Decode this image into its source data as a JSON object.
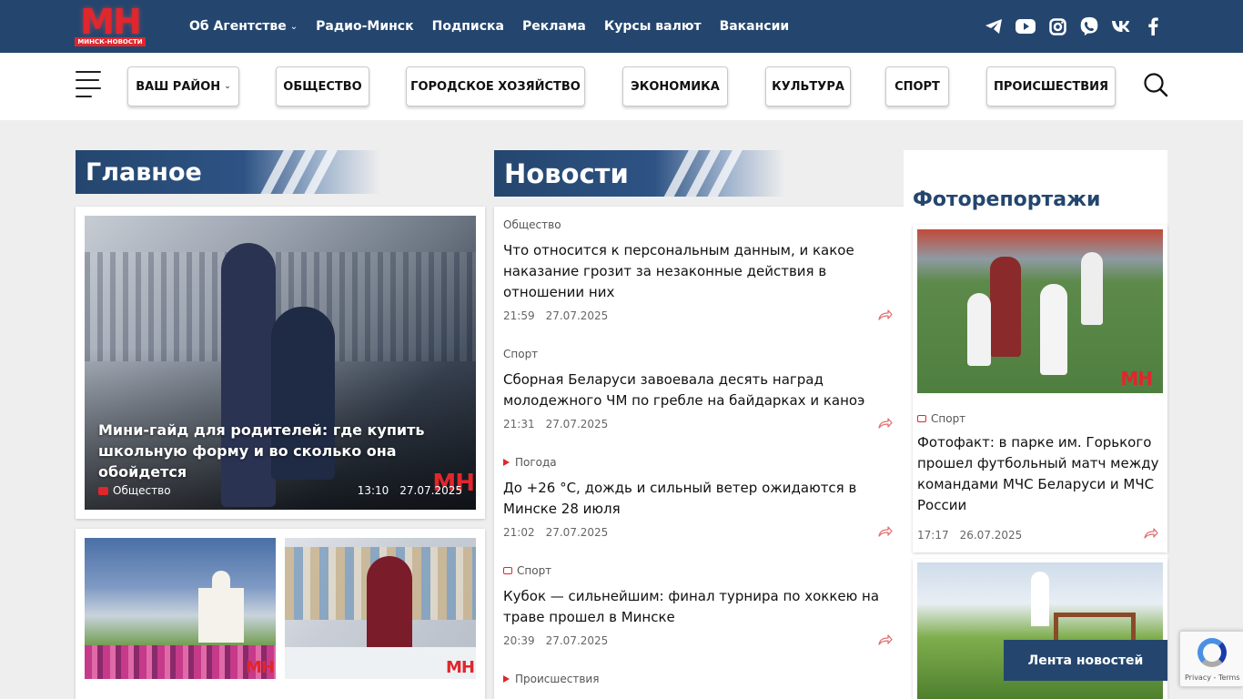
{
  "logo": {
    "letters": "МН",
    "subtitle": "МИНСК-НОВОСТИ"
  },
  "topnav": [
    {
      "label": "Об Агентстве",
      "dropdown": true
    },
    {
      "label": "Радио-Минск"
    },
    {
      "label": "Подписка"
    },
    {
      "label": "Реклама"
    },
    {
      "label": "Курсы валют"
    },
    {
      "label": "Вакансии"
    }
  ],
  "social": [
    "telegram-icon",
    "youtube-icon",
    "instagram-icon",
    "viber-icon",
    "vk-icon",
    "facebook-icon"
  ],
  "categories": [
    {
      "label": "ВАШ РАЙОН",
      "dropdown": true
    },
    {
      "label": "ОБЩЕСТВО"
    },
    {
      "label": "ГОРОДСКОЕ ХОЗЯЙСТВО"
    },
    {
      "label": "ЭКОНОМИКА"
    },
    {
      "label": "КУЛЬТУРА"
    },
    {
      "label": "СПОРТ"
    },
    {
      "label": "ПРОИСШЕСТВИЯ"
    }
  ],
  "main": {
    "heading": "Главное",
    "featured": {
      "title": "Мини-гайд для родителей: где купить школьную форму и во сколько она обойдется",
      "category": "Общество",
      "time": "13:10",
      "date": "27.07.2025",
      "watermark": "МН"
    },
    "thumb_watermark": "МН"
  },
  "news": {
    "heading": "Новости",
    "items": [
      {
        "category": "Общество",
        "marker": "none",
        "title": "Что относится к персональным данным, и какое наказание грозит за незаконные действия в отношении них",
        "time": "21:59",
        "date": "27.07.2025"
      },
      {
        "category": "Спорт",
        "marker": "none",
        "title": "Сборная Беларуси завоевала десять наград молодежного ЧМ по гребле на байдарках и каноэ",
        "time": "21:31",
        "date": "27.07.2025"
      },
      {
        "category": "Погода",
        "marker": "video",
        "title": "До +26 °С, дождь и сильный ветер ожидаются в Минске 28 июля",
        "time": "21:02",
        "date": "27.07.2025"
      },
      {
        "category": "Спорт",
        "marker": "photo",
        "title": "Кубок — сильнейшим: финал турнира по хоккею на траве прошел в Минске",
        "time": "20:39",
        "date": "27.07.2025"
      },
      {
        "category": "Происшествия",
        "marker": "video",
        "title": "",
        "time": "",
        "date": ""
      }
    ]
  },
  "photos": {
    "heading": "Фоторепортажи",
    "card": {
      "category": "Спорт",
      "title": "Фотофакт: в парке им. Горького прошел футбольный матч между командами МЧС Беларуси и МЧС России",
      "time": "17:17",
      "date": "26.07.2025",
      "watermark": "МН"
    }
  },
  "lenta_label": "Лента новостей",
  "recaptcha": {
    "text": "Privacy - Terms"
  },
  "colors": {
    "brand": "#24466e",
    "accent": "#e1262c"
  }
}
